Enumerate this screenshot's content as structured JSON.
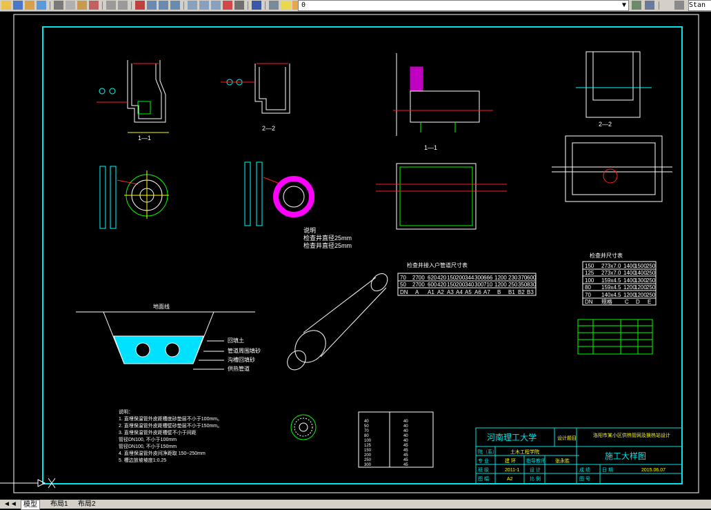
{
  "toolbar": {
    "layer_value": "0",
    "style_value": "Stan"
  },
  "tabs": [
    "模型",
    "布局1",
    "布局2"
  ],
  "drawing": {
    "view_labels": {
      "sec_11_a": "1—1",
      "sec_22_a": "2—2",
      "sec_11_b": "1—1",
      "sec_22_b": "2—2"
    },
    "notes_left": [
      "说明",
      "检查井直径25mm",
      "检查井直径25mm"
    ],
    "layer_labels": [
      "回填土",
      "管道周围填砂",
      "沟槽回填砂",
      "供热管道"
    ],
    "surface_label": "地面线",
    "table1": {
      "title": "检查井接入户管道尺寸表",
      "rows": [
        [
          "70",
          "2700",
          "620",
          "420",
          "150",
          "200",
          "344",
          "300",
          "666",
          "1200",
          "230",
          "370",
          "600"
        ],
        [
          "50",
          "2700",
          "600",
          "420",
          "150",
          "200",
          "340",
          "300",
          "710",
          "1200",
          "250",
          "350",
          "830"
        ],
        [
          "DN",
          "A",
          "A1",
          "A2",
          "A3",
          "A4",
          "A5",
          "A6",
          "A7",
          "B",
          "B1",
          "B2",
          "B3"
        ]
      ]
    },
    "table2": {
      "title": "检查井尺寸表",
      "rows": [
        [
          "150",
          "273x7.0",
          "1400",
          "1500",
          "250"
        ],
        [
          "125",
          "273x7.0",
          "1400",
          "1400",
          "250"
        ],
        [
          "100",
          "159x4.5",
          "1400",
          "1300",
          "250"
        ],
        [
          "80",
          "159x4.5",
          "1200",
          "1200",
          "250"
        ],
        [
          "70",
          "140x4.5",
          "1200",
          "1200",
          "250"
        ],
        [
          "DN",
          "规格",
          "C",
          "D",
          "E"
        ]
      ]
    },
    "table3_rows": [
      [
        "40",
        "40"
      ],
      [
        "50",
        "40"
      ],
      [
        "70",
        "40"
      ],
      [
        "80",
        "40"
      ],
      [
        "100",
        "40"
      ],
      [
        "125",
        "45"
      ],
      [
        "150",
        "45"
      ],
      [
        "200",
        "45"
      ],
      [
        "250",
        "45"
      ],
      [
        "300",
        "45"
      ]
    ],
    "notes": [
      "说明：",
      "1. 直埋保温管外皮距槽底砂垫层不小于100mm。",
      "2. 直埋保温管外皮距槽壁砂垫层不小于150mm。",
      "3. 直埋保温管外皮距槽壁不小于间距",
      "     管径DN100, 不小于100mm",
      "     管径DN100, 不小于150mm",
      "4. 直埋保温管外皮间净距取 150~250mm",
      "5. 槽边放坡坡度1:0.25"
    ],
    "title_block": {
      "university": "河南理工大学",
      "design_topic": "设计题目",
      "project": "洛阳市某小区供热管网及换热站设计",
      "dept_label": "院（系）",
      "dept": "土木工程学院",
      "major_label": "专 业",
      "major": "建 环",
      "advisor_label": "指导教师",
      "advisor": "张永胜",
      "drawing_name": "施工大样图",
      "class_label": "班 级",
      "class": "2011-1",
      "designer_label": "设 计",
      "score_label": "成 绩",
      "date_label": "日 期",
      "date": "2015.06.07",
      "sheet_label": "图 幅",
      "sheet": "A2",
      "scale_label": "比 例",
      "page_label": "图 号"
    }
  }
}
